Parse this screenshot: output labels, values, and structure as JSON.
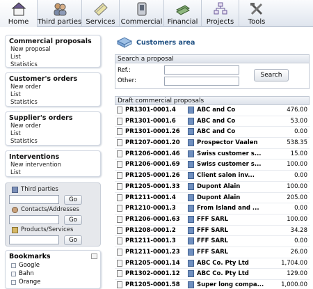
{
  "topmenu": [
    {
      "label": "Home",
      "icon": "home-icon"
    },
    {
      "label": "Third parties",
      "icon": "third-parties-icon"
    },
    {
      "label": "Services",
      "icon": "services-icon"
    },
    {
      "label": "Commercial",
      "icon": "commercial-icon"
    },
    {
      "label": "Financial",
      "icon": "financial-icon"
    },
    {
      "label": "Projects",
      "icon": "projects-icon"
    },
    {
      "label": "Tools",
      "icon": "tools-icon"
    }
  ],
  "leftmenu": [
    {
      "title": "Commercial proposals",
      "items": [
        "New proposal",
        "List",
        "Statistics"
      ]
    },
    {
      "title": "Customer's orders",
      "items": [
        "New order",
        "List",
        "Statistics"
      ]
    },
    {
      "title": "Supplier's orders",
      "items": [
        "New order",
        "List",
        "Statistics"
      ]
    },
    {
      "title": "Interventions",
      "items": [
        "New intervention",
        "List"
      ]
    }
  ],
  "quicksearch": {
    "third_parties": "Third parties",
    "contacts": "Contacts/Addresses",
    "products": "Products/Services",
    "go": "Go"
  },
  "bookmarks": {
    "title": "Bookmarks",
    "items": [
      "Google",
      "Bahn",
      "Orange"
    ]
  },
  "area_title": "Customers area",
  "search": {
    "title": "Search a proposal",
    "ref_label": "Ref.:",
    "other_label": "Other:",
    "button": "Search"
  },
  "drafts": {
    "title": "Draft commercial proposals",
    "rows": [
      {
        "ref": "PR1301-0001.4",
        "company": "ABC and Co",
        "amount": "476.00"
      },
      {
        "ref": "PR1301-0001.6",
        "company": "ABC and Co",
        "amount": "53.00"
      },
      {
        "ref": "PR1301-0001.26",
        "company": "ABC and Co",
        "amount": "0.00"
      },
      {
        "ref": "PR1207-0001.20",
        "company": "Prospector Vaalen",
        "amount": "538.35"
      },
      {
        "ref": "PR1206-0001.46",
        "company": "Swiss customer s...",
        "amount": "15.00"
      },
      {
        "ref": "PR1206-0001.69",
        "company": "Swiss customer s...",
        "amount": "100.00"
      },
      {
        "ref": "PR1205-0001.26",
        "company": "Client salon inv...",
        "amount": "0.00"
      },
      {
        "ref": "PR1205-0001.33",
        "company": "Dupont Alain",
        "amount": "100.00"
      },
      {
        "ref": "PR1211-0001.4",
        "company": "Dupont Alain",
        "amount": "205.00"
      },
      {
        "ref": "PR1210-0001.3",
        "company": "From Island and ...",
        "amount": "0.00"
      },
      {
        "ref": "PR1206-0001.63",
        "company": "FFF SARL",
        "amount": "100.00"
      },
      {
        "ref": "PR1208-0001.2",
        "company": "FFF SARL",
        "amount": "34.28"
      },
      {
        "ref": "PR1211-0001.3",
        "company": "FFF SARL",
        "amount": "0.00"
      },
      {
        "ref": "PR1211-0001.23",
        "company": "FFF SARL",
        "amount": "26.00"
      },
      {
        "ref": "PR1205-0001.14",
        "company": "ABC Co. Pty Ltd",
        "amount": "1,704.00"
      },
      {
        "ref": "PR1302-0001.12",
        "company": "ABC Co. Pty Ltd",
        "amount": "129.00"
      },
      {
        "ref": "PR1205-0001.58",
        "company": "Super long compa...",
        "amount": "1,000.00"
      }
    ]
  }
}
